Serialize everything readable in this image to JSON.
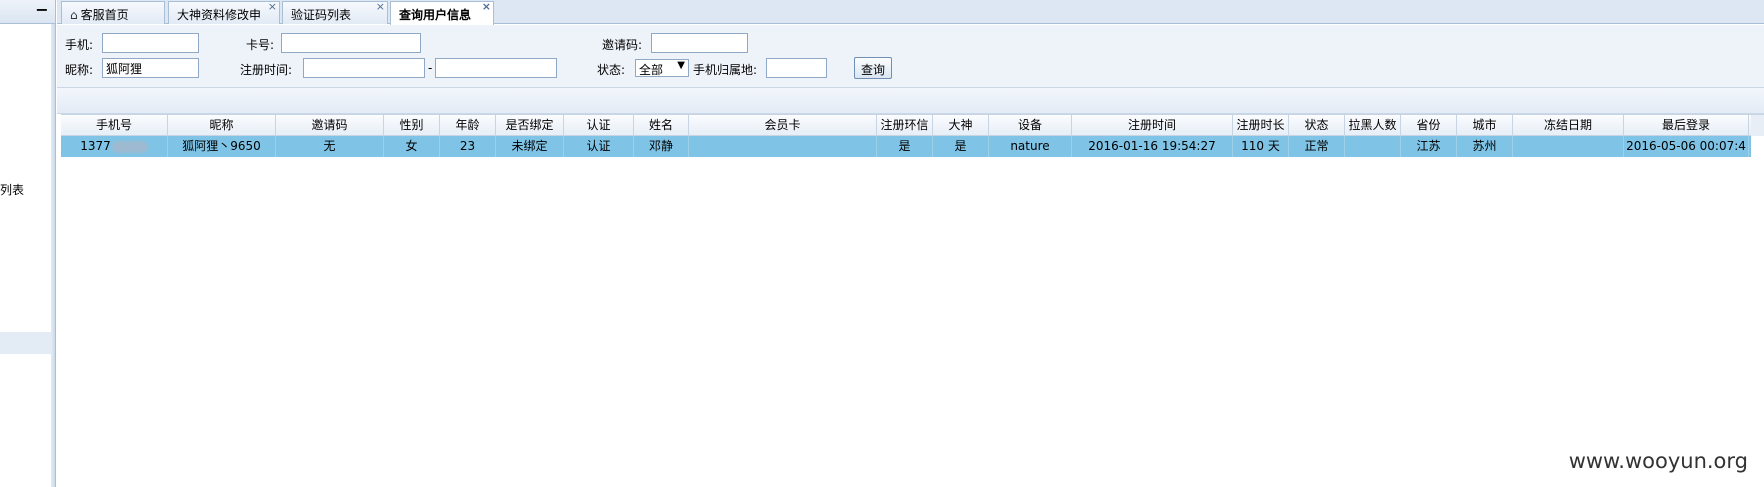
{
  "sidebar": {
    "collapse_icon": "minus",
    "partial_item_label": "列表"
  },
  "tabs": [
    {
      "label": "客服首页",
      "icon": "home-icon",
      "closable": false
    },
    {
      "label": "大神资料修改申",
      "closable": true
    },
    {
      "label": "验证码列表",
      "closable": true
    },
    {
      "label": "查询用户信息",
      "closable": true,
      "active": true
    }
  ],
  "close_glyph": "×",
  "form": {
    "phone_label": "手机:",
    "phone_value": "",
    "card_label": "卡号:",
    "card_value": "",
    "invite_label": "邀请码:",
    "invite_value": "",
    "nickname_label": "昵称:",
    "nickname_value": "狐阿狸",
    "regtime_label": "注册时间:",
    "regtime_start": "",
    "regtime_sep": "-",
    "regtime_end": "",
    "status_label": "状态:",
    "status_value": "全部",
    "phone_region_label": "手机归属地:",
    "phone_region_value": "",
    "query_button": "查询"
  },
  "grid": {
    "columns": [
      "手机号",
      "昵称",
      "邀请码",
      "性别",
      "年龄",
      "是否绑定",
      "认证",
      "姓名",
      "会员卡",
      "注册环信",
      "大神",
      "设备",
      "注册时间",
      "注册时长",
      "状态",
      "拉黑人数",
      "省份",
      "城市",
      "冻结日期",
      "最后登录"
    ],
    "rows": [
      [
        "1377",
        "狐阿狸丶9650",
        "无",
        "女",
        "23",
        "未绑定",
        "认证",
        "邓静",
        "",
        "是",
        "是",
        "nature",
        "2016-01-16 19:54:27",
        "110 天",
        "正常",
        "",
        "江苏",
        "苏州",
        "",
        "2016-05-06 00:07:4"
      ]
    ]
  },
  "watermark": "www.wooyun.org",
  "colors": {
    "selected_row": "#7fc4e6",
    "tab_border": "#a9bfd6",
    "form_bg": "#eef3f9"
  }
}
